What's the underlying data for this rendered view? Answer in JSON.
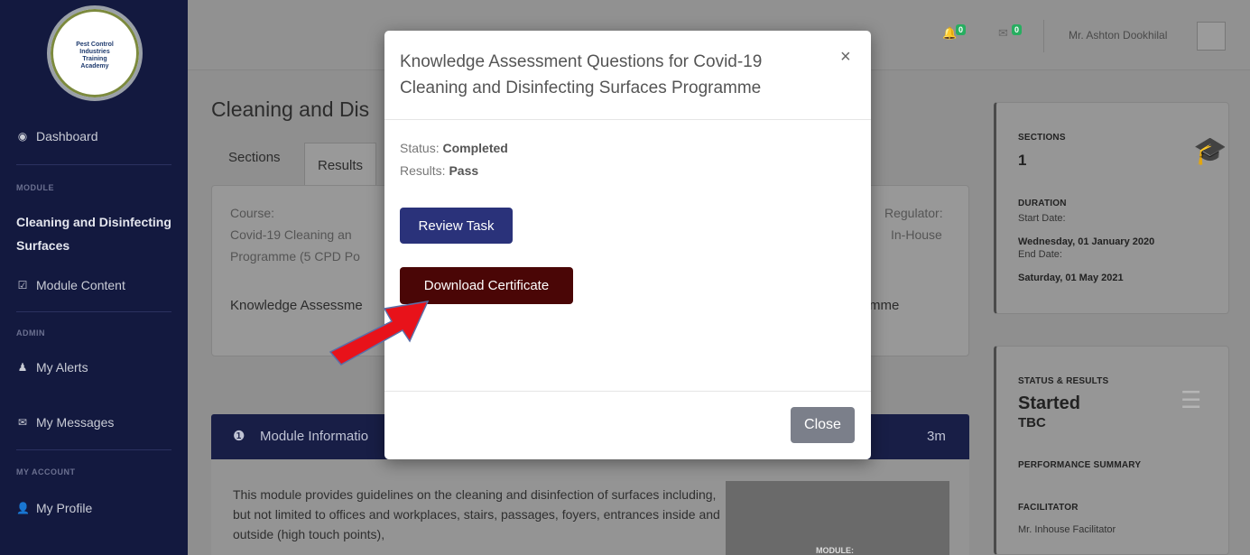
{
  "sidebar": {
    "logo_text": "Pest Control\nIndustries\nTraining\nAcademy",
    "dashboard": "Dashboard",
    "module_heading": "MODULE",
    "module_active": "Cleaning and Disinfecting Surfaces",
    "module_content": "Module Content",
    "admin_heading": "ADMIN",
    "my_alerts": "My Alerts",
    "my_messages": "My Messages",
    "account_heading": "MY ACCOUNT",
    "my_profile": "My Profile"
  },
  "topbar": {
    "alerts_badge": "0",
    "messages_badge": "0",
    "user_name": "Mr. Ashton Dookhilal"
  },
  "main": {
    "title_partial": "Cleaning and Dis",
    "tabs": [
      "Sections",
      "Results"
    ],
    "course_label": "Course:",
    "course_line1": "Covid-19 Cleaning an",
    "course_line2": "Programme (5 CPD Po",
    "regulator_label": "Regulator:",
    "regulator_value": "In-House",
    "assessment_partial_left": "Knowledge Assessme",
    "assessment_partial_right": "mme",
    "module_info": "Module Informatio",
    "module_duration": "3m",
    "module_text": "This module provides guidelines on the cleaning and disinfection of surfaces including, but not limited to offices and workplaces, stairs, passages, foyers, entrances inside and outside (high touch points),",
    "image_caption": "MODULE:"
  },
  "right_panel": {
    "sections_label": "SECTIONS",
    "sections_value": "1",
    "duration_label": "DURATION",
    "start_label": "Start Date:",
    "start_value": "Wednesday, 01 January 2020",
    "end_label": "End Date:",
    "end_value": "Saturday, 01 May 2021",
    "status_label": "STATUS & RESULTS",
    "status_value": "Started",
    "result_value": "TBC",
    "performance_label": "PERFORMANCE SUMMARY",
    "facilitator_label": "FACILITATOR",
    "facilitator_value": "Mr. Inhouse Facilitator"
  },
  "modal": {
    "title": "Knowledge Assessment Questions for Covid-19 Cleaning and Disinfecting Surfaces Programme",
    "close_x": "×",
    "status_label": "Status:",
    "status_value": "Completed",
    "results_label": "Results:",
    "results_value": "Pass",
    "review_button": "Review Task",
    "certificate_button": "Download Certificate",
    "close_button": "Close"
  },
  "colors": {
    "sidebar_bg": "#13193f",
    "review_btn": "#2a327a",
    "certificate_btn": "#4a0606",
    "arrow": "#e8121a",
    "close_btn": "#7b7f8a"
  },
  "icons": [
    "dashboard-icon",
    "checkbox-icon",
    "alert-user-icon",
    "envelope-icon",
    "user-icon",
    "bell-icon",
    "message-icon",
    "graduation-cap-icon",
    "checklist-icon",
    "info-icon",
    "red-arrow-icon"
  ]
}
